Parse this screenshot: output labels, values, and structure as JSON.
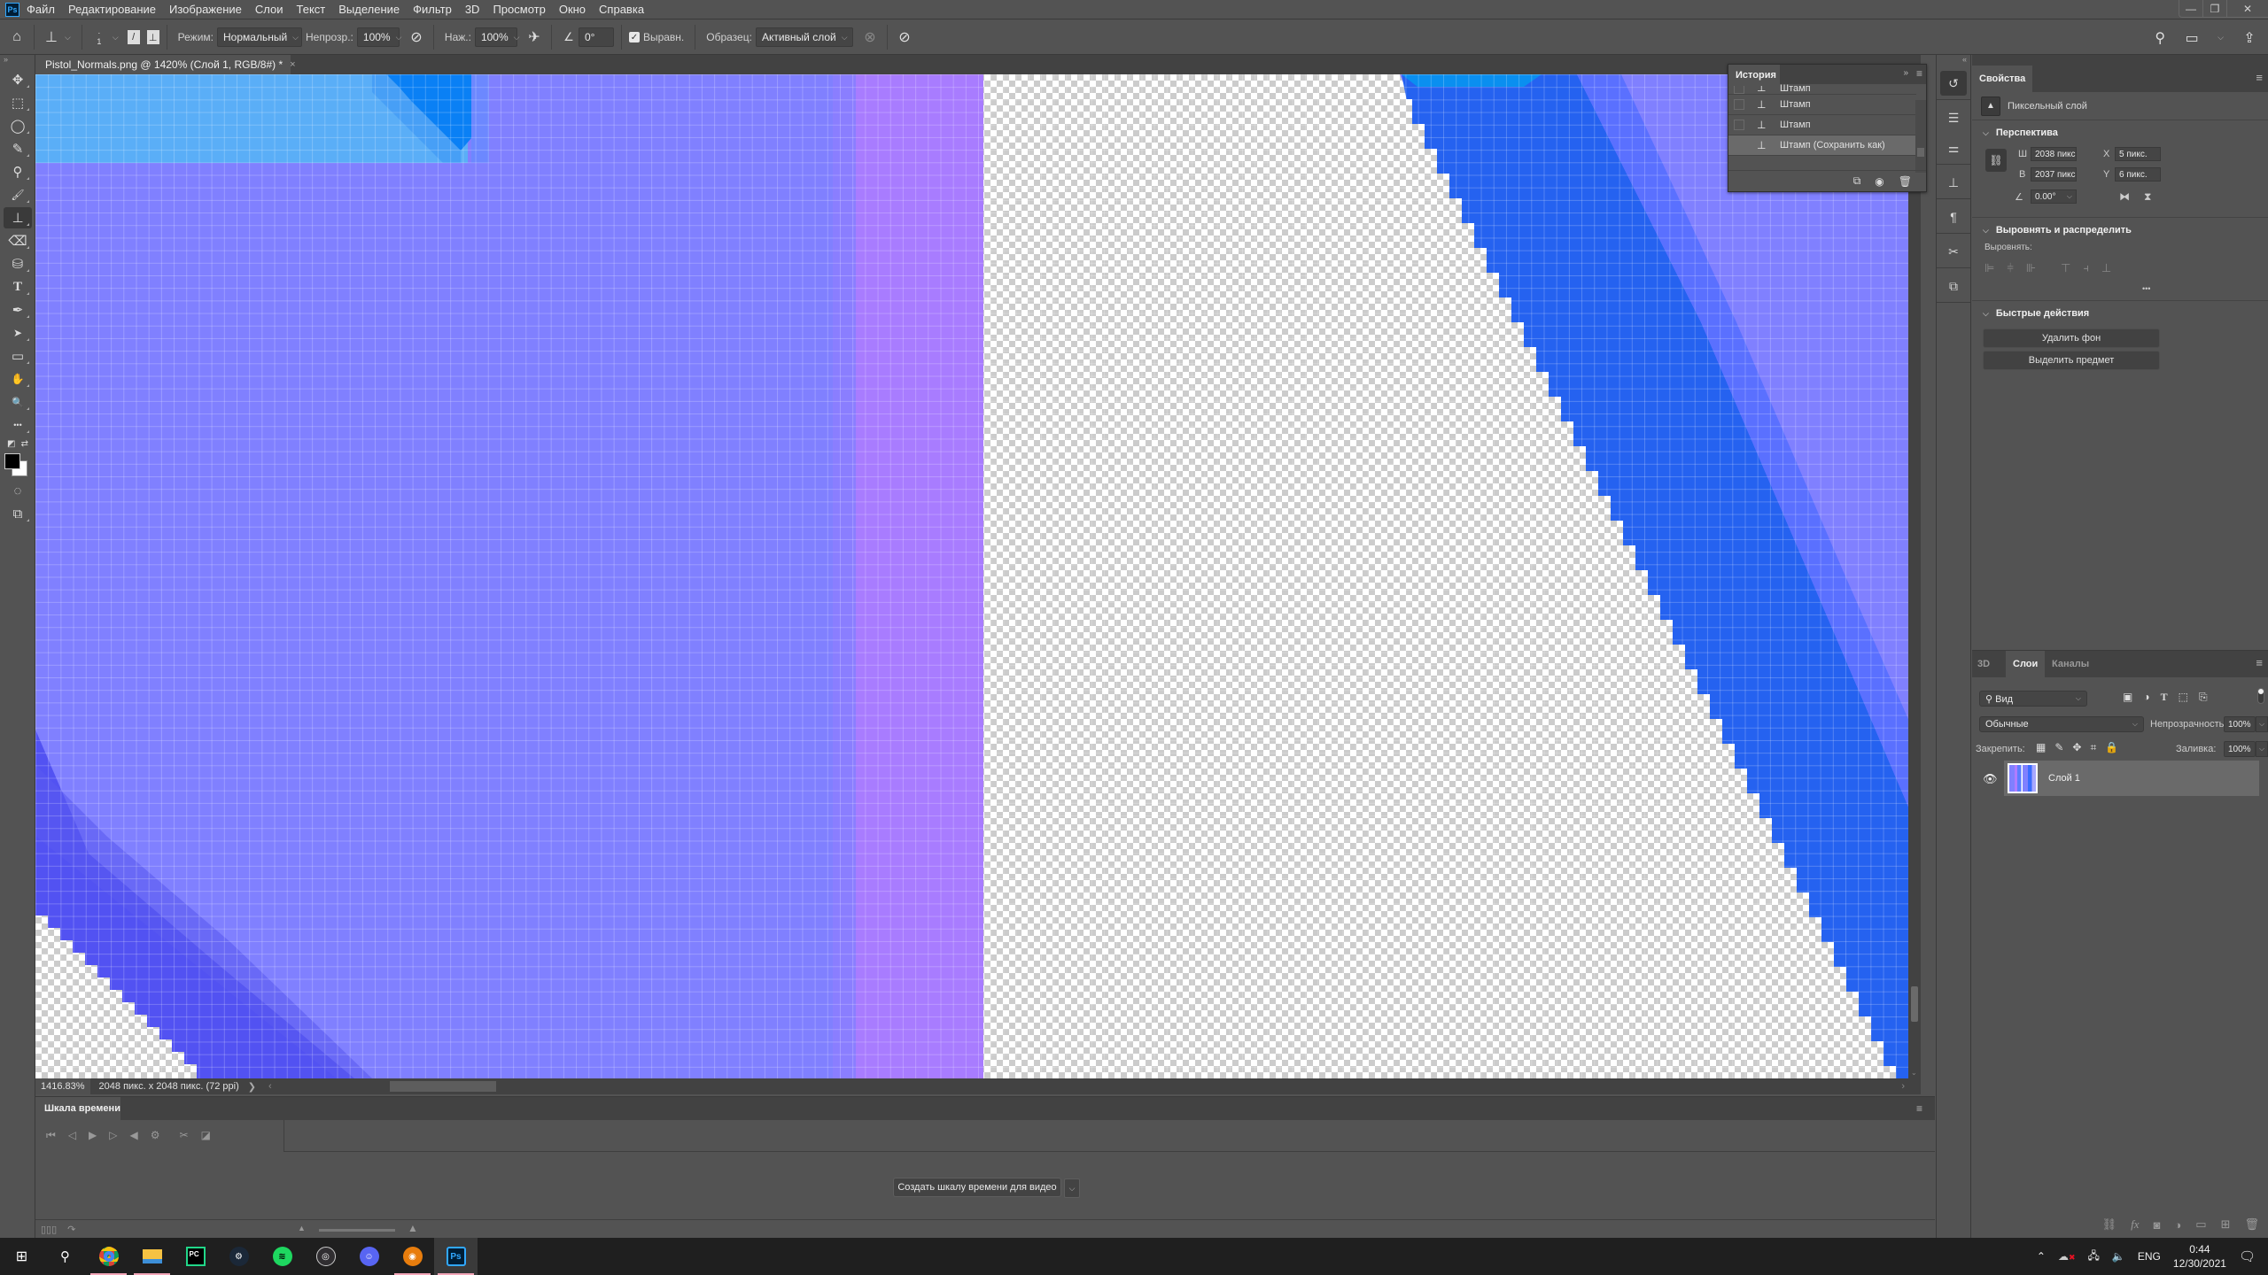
{
  "app": {
    "logo": "Ps",
    "menu": [
      "Файл",
      "Редактирование",
      "Изображение",
      "Слои",
      "Текст",
      "Выделение",
      "Фильтр",
      "3D",
      "Просмотр",
      "Окно",
      "Справка"
    ],
    "window_controls": {
      "minimize": "—",
      "restore": "❐",
      "close": "✕"
    }
  },
  "options_bar": {
    "brush_size": "1",
    "mode_label": "Режим:",
    "mode_value": "Нормальный",
    "opacity_label": "Непрозр.:",
    "opacity_value": "100%",
    "flow_label": "Наж.:",
    "flow_value": "100%",
    "angle_value": "0°",
    "aligned_label": "Выравн.",
    "aligned_checked": true,
    "sample_label": "Образец:",
    "sample_value": "Активный слой"
  },
  "document": {
    "tab_title": "Pistol_Normals.png @ 1420% (Слой 1, RGB/8#) *",
    "close": "×",
    "zoom_readout": "1416.83%",
    "size_info": "2048 пикс. x 2048 пикс. (72 ppi)",
    "status_arrow": "❯"
  },
  "canvas_colors": {
    "base": "#8080ff",
    "light_blue": "#5aaef7",
    "bright_blue": "#0a80f5",
    "violet": "#a87cff",
    "mid_blue": "#2562f0",
    "deep_indigo": "#5252f2",
    "grid_line": "rgba(255,255,255,0.22)"
  },
  "toolbar": {
    "tools": [
      {
        "name": "move-tool",
        "glyph": "✥"
      },
      {
        "name": "marquee-tool",
        "glyph": "⬚"
      },
      {
        "name": "lasso-tool",
        "glyph": "◯"
      },
      {
        "name": "quick-selection-tool",
        "glyph": "✎"
      },
      {
        "name": "eyedropper-tool",
        "glyph": "⚲"
      },
      {
        "name": "brush-tool",
        "glyph": "🖌"
      },
      {
        "name": "clone-stamp-tool",
        "glyph": "⊥",
        "active": true
      },
      {
        "name": "eraser-tool",
        "glyph": "⌫"
      },
      {
        "name": "paint-bucket-tool",
        "glyph": "⛁"
      },
      {
        "name": "type-tool",
        "glyph": "T"
      },
      {
        "name": "pen-tool",
        "glyph": "✒"
      },
      {
        "name": "path-selection-tool",
        "glyph": "➤"
      },
      {
        "name": "rectangle-tool",
        "glyph": "▭"
      },
      {
        "name": "hand-tool",
        "glyph": "✋"
      },
      {
        "name": "zoom-tool",
        "glyph": "🔍"
      },
      {
        "name": "more-tools",
        "glyph": "•••"
      }
    ],
    "foreground_color": "#000000",
    "background_color": "#ffffff"
  },
  "history": {
    "title": "История",
    "items": [
      {
        "label": "Штамп",
        "partial": true
      },
      {
        "label": "Штамп"
      },
      {
        "label": "Штамп"
      },
      {
        "label": "Штамп (Сохранить как)",
        "selected": true
      }
    ]
  },
  "properties": {
    "title": "Свойства",
    "layer_type": "Пиксельный слой",
    "transform_section": "Перспектива",
    "w_label": "Ш",
    "w_value": "2038 пикс",
    "h_label": "В",
    "h_value": "2037 пикс",
    "x_label": "X",
    "x_value": "5 пикс.",
    "y_label": "Y",
    "y_value": "6 пикс.",
    "angle_value": "0.00°",
    "align_section": "Выровнять и распределить",
    "align_label": "Выровнять:",
    "more": "•••",
    "quick_actions_section": "Быстрые действия",
    "remove_bg": "Удалить фон",
    "select_subject": "Выделить предмет"
  },
  "layers_panel": {
    "tabs": [
      "3D",
      "Слои",
      "Каналы"
    ],
    "active_tab": "Слои",
    "filter_value": "Вид",
    "blend_mode": "Обычные",
    "opacity_label": "Непрозрачность:",
    "opacity_value": "100%",
    "lock_label": "Закрепить:",
    "fill_label": "Заливка:",
    "fill_value": "100%",
    "layers": [
      {
        "name": "Слой 1",
        "visible": true,
        "selected": true
      }
    ]
  },
  "timeline": {
    "title": "Шкала времени",
    "create_button": "Создать шкалу времени для видео"
  },
  "taskbar": {
    "apps": [
      "Start",
      "Search",
      "Chrome",
      "File Explorer",
      "PyCharm",
      "Steam",
      "Spotify",
      "OBS",
      "Discord",
      "Blender",
      "Photoshop"
    ],
    "language": "ENG",
    "time": "0:44",
    "date": "12/30/2021"
  }
}
